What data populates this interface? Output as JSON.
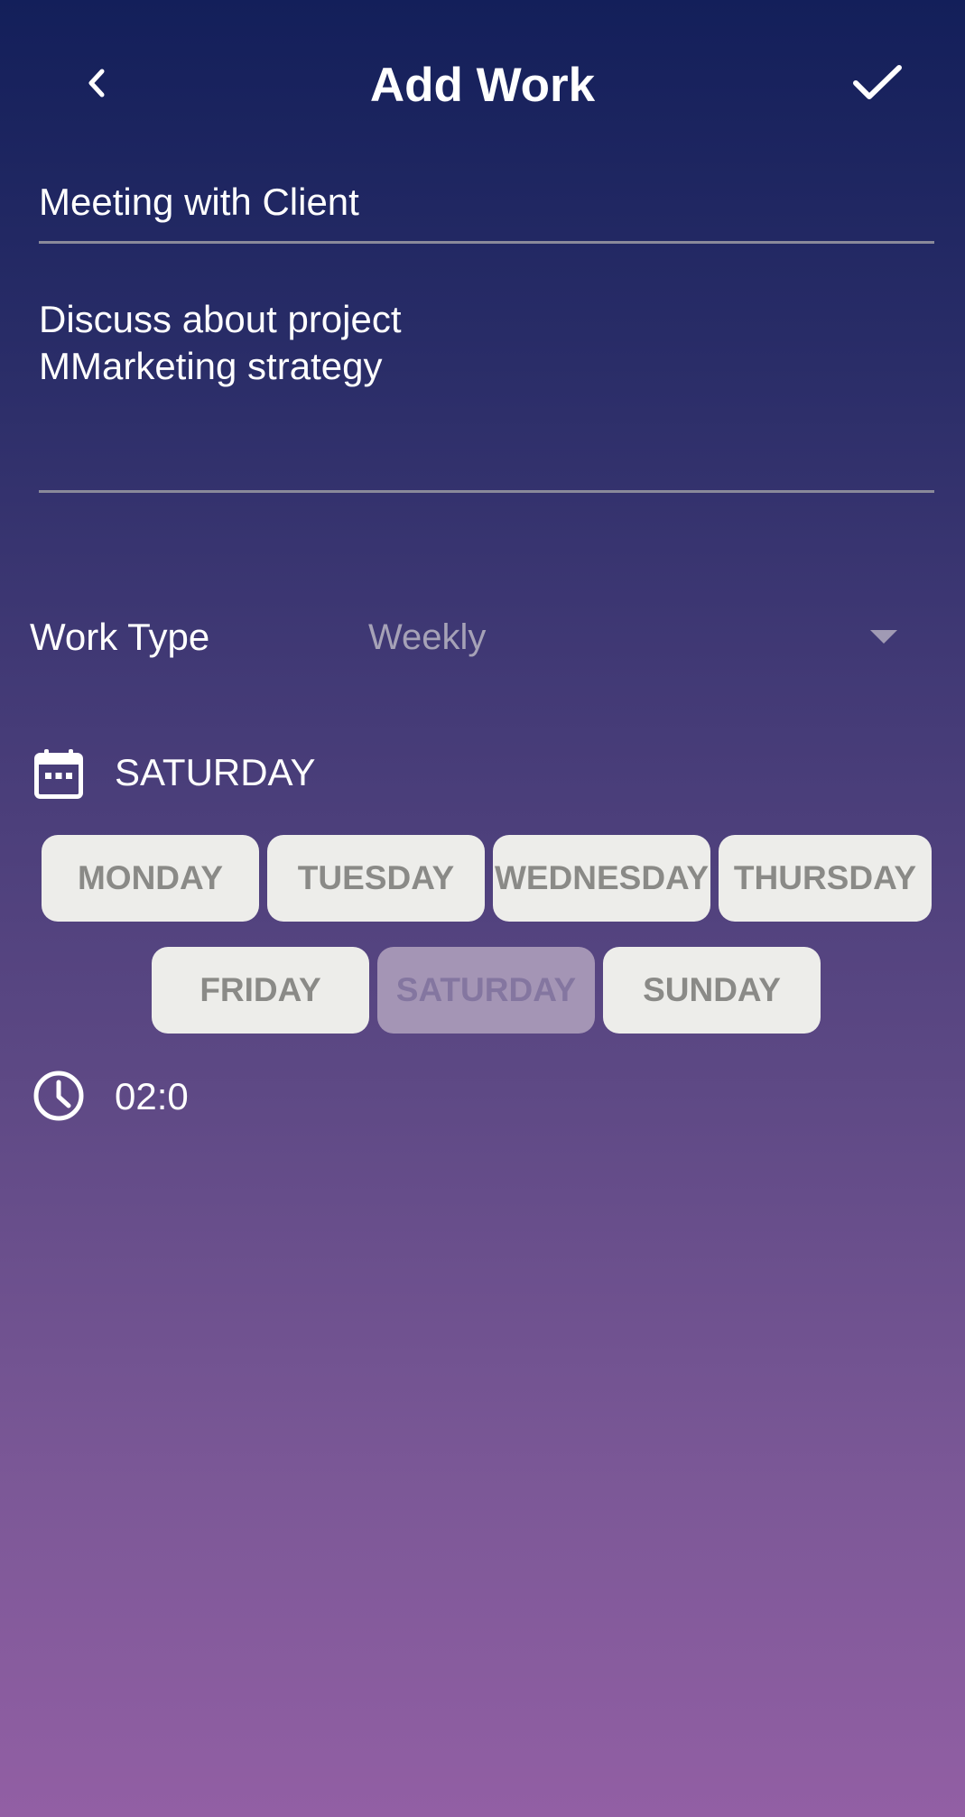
{
  "header": {
    "title": "Add Work",
    "back_icon": "chevron-left-icon",
    "save_icon": "check-icon"
  },
  "form": {
    "work_title": "Meeting with Client",
    "description": "Discuss about project\nMMarketing strategy"
  },
  "work_type": {
    "label": "Work Type",
    "selected": "Weekly",
    "dropdown_icon": "dropdown-arrow-icon"
  },
  "selected_day": {
    "icon": "calendar-icon",
    "value": "SATURDAY"
  },
  "days": [
    {
      "label": "MONDAY",
      "selected": false
    },
    {
      "label": "TUESDAY",
      "selected": false
    },
    {
      "label": "WEDNESDAY",
      "selected": false
    },
    {
      "label": "THURSDAY",
      "selected": false
    },
    {
      "label": "FRIDAY",
      "selected": false
    },
    {
      "label": "SATURDAY",
      "selected": true
    },
    {
      "label": "SUNDAY",
      "selected": false
    }
  ],
  "time": {
    "icon": "clock-icon",
    "value": "02:0"
  },
  "colors": {
    "gradient_top": "#131f5a",
    "gradient_bottom": "#925fa4",
    "chip_background": "#ededea",
    "chip_selected_background": "#a495b5",
    "chip_text": "#8a8a87"
  }
}
